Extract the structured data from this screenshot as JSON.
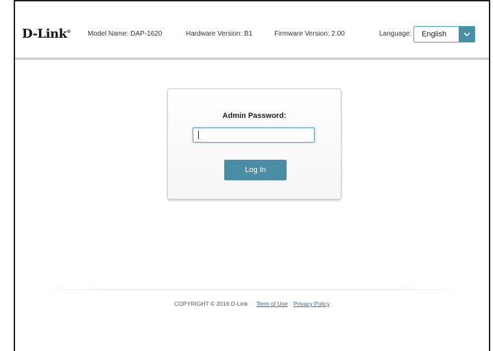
{
  "header": {
    "logo": "D-Link",
    "logo_mark": "®",
    "model_name": "Model Name: DAP-1620",
    "hardware_version": "Hardware Version: B1",
    "firmware_version": "Firmware Version: 2.00",
    "language_label": "Language:",
    "language_value": "English",
    "dropdown_icon": "chevron-down-icon"
  },
  "login": {
    "password_label": "Admin Password:",
    "password_value": "",
    "login_button": "Log In"
  },
  "footer": {
    "copyright": "COPYRIGHT © 2016 D-Link",
    "terms_link": "Term of Use",
    "privacy_link": "Privacy Policy"
  },
  "colors": {
    "accent": "#4a8ea6",
    "input_border": "#5a9fc4",
    "link": "#2c6aa0"
  }
}
